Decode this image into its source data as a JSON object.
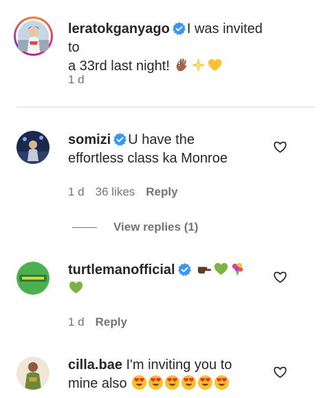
{
  "comments": [
    {
      "username": "leratokganyago",
      "verified": true,
      "text_1": "I was invited to",
      "text_2": "a 33rd last night!",
      "time": "1 d",
      "likes": "",
      "reply_label": ""
    },
    {
      "username": "somizi",
      "verified": true,
      "text_1": "U have the",
      "text_2": "effortless class ka Monroe",
      "time": "1 d",
      "likes": "36 likes",
      "reply_label": "Reply"
    },
    {
      "username": "turtlemanofficial",
      "verified": true,
      "text_1": "",
      "text_2": "",
      "time": "1 d",
      "likes": "",
      "reply_label": "Reply"
    },
    {
      "username": "cilla.bae",
      "verified": false,
      "text_1": "I'm inviting you to",
      "text_2": "mine also",
      "time": "",
      "likes": "",
      "reply_label": ""
    }
  ],
  "view_replies": "View replies (1)",
  "colors": {
    "verified": "#3897f0",
    "muted": "#737373",
    "divider": "#dbdbdb"
  },
  "icons": [
    "verified-badge-icon",
    "heart-icon",
    "ok-hand-emoji",
    "sparkle-emoji",
    "yellow-heart-emoji",
    "pointing-right-emoji",
    "green-heart-emoji",
    "bouquet-emoji",
    "heart-eyes-emoji"
  ]
}
